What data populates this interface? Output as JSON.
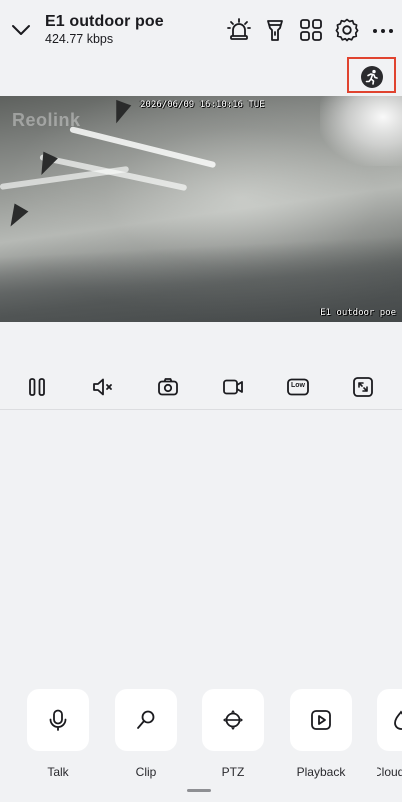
{
  "header": {
    "title": "E1 outdoor poe",
    "bitrate": "424.77 kbps",
    "icons": [
      "chevron-down-icon",
      "siren-icon",
      "flashlight-icon",
      "grid-icon",
      "gear-icon",
      "more-icon"
    ]
  },
  "motion_indicator": {
    "icon": "running-person-icon"
  },
  "video": {
    "timestamp": "2026/06/09 16:10:16 TUE",
    "watermark": "Reolink",
    "camera_name": "E1 outdoor poe"
  },
  "controls": [
    "pause-icon",
    "mute-icon",
    "snapshot-icon",
    "record-icon",
    "quality-icon",
    "fullscreen-icon"
  ],
  "quality_label": "Low",
  "quick_actions": [
    {
      "label": "Talk",
      "icon": "microphone-icon"
    },
    {
      "label": "Clip",
      "icon": "clip-icon"
    },
    {
      "label": "PTZ",
      "icon": "ptz-icon"
    },
    {
      "label": "Playback",
      "icon": "playback-icon"
    },
    {
      "label": "Cloud",
      "icon": "cloud-icon"
    }
  ],
  "colors": {
    "background": "#f1f2f4",
    "highlight_border": "#e0432f",
    "card": "#ffffff"
  }
}
